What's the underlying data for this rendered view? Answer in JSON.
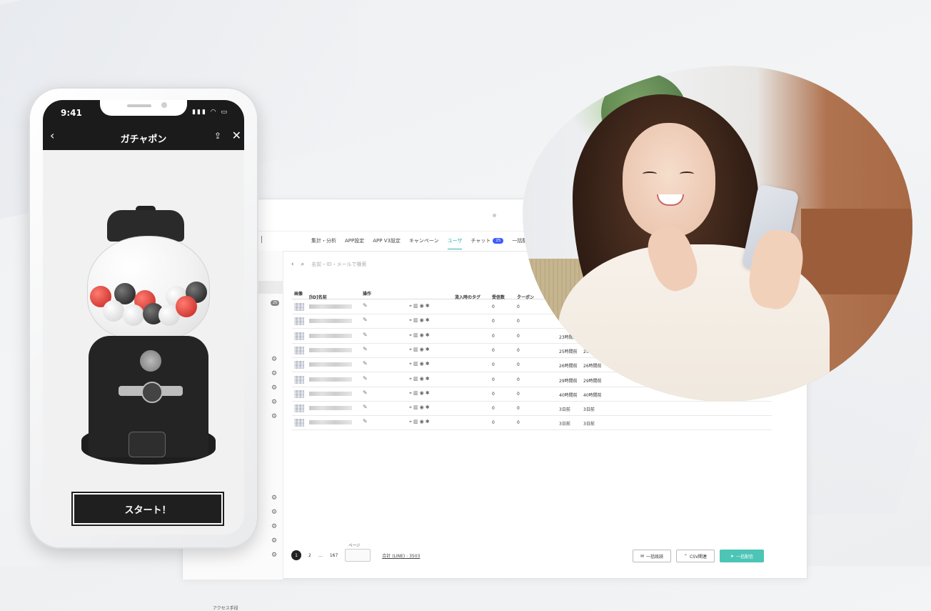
{
  "phone": {
    "time": "9:41",
    "status_icons": "▮▮▮ ◠ ▭",
    "back_glyph": "‹",
    "title": "ガチャポン",
    "share_glyph": "⇪",
    "close_glyph": "✕",
    "start_label": "スタート！"
  },
  "admin": {
    "nav": [
      {
        "label": "集計・分析"
      },
      {
        "label": "APP設定"
      },
      {
        "label": "APP V3設定"
      },
      {
        "label": "キャンペーン"
      },
      {
        "label": "ユーザ",
        "active": true
      },
      {
        "label": "チャット",
        "badge": "25"
      },
      {
        "label": "一括配信"
      }
    ],
    "sidebar_badge": "25",
    "sidebar_footer": "アクセス手段",
    "search_placeholder": "名前・ID・メールで検索",
    "columns": {
      "image": "画像",
      "name": "[ID]名前",
      "ops": "操作",
      "tag": "流入時のタグ",
      "received": "受信数",
      "coupon": "クーポン"
    },
    "rows": [
      {
        "c1": "0",
        "c2": "0",
        "c3": "",
        "c4": ""
      },
      {
        "c1": "0",
        "c2": "0",
        "c3": "",
        "c4": ""
      },
      {
        "c1": "0",
        "c2": "0",
        "c3": "23時間前",
        "c4": ""
      },
      {
        "c1": "0",
        "c2": "0",
        "c3": "25時間前",
        "c4": "25時間前"
      },
      {
        "c1": "0",
        "c2": "0",
        "c3": "26時間前",
        "c4": "26時間前"
      },
      {
        "c1": "0",
        "c2": "0",
        "c3": "29時間前",
        "c4": "29時間前"
      },
      {
        "c1": "0",
        "c2": "0",
        "c3": "40時間前",
        "c4": "40時間前"
      },
      {
        "c1": "0",
        "c2": "0",
        "c3": "3日前",
        "c4": "3日前"
      },
      {
        "c1": "0",
        "c2": "0",
        "c3": "3日前",
        "c4": "3日前"
      }
    ],
    "pager": {
      "current": "1",
      "next": "2",
      "ellipsis": "…",
      "last": "167",
      "page_label": "ページ",
      "total": "合計 (LINE) : 3503"
    },
    "buttons": {
      "bulk_read": "一括既読",
      "csv": "CSV関連",
      "bulk_send": "一括配信"
    }
  }
}
